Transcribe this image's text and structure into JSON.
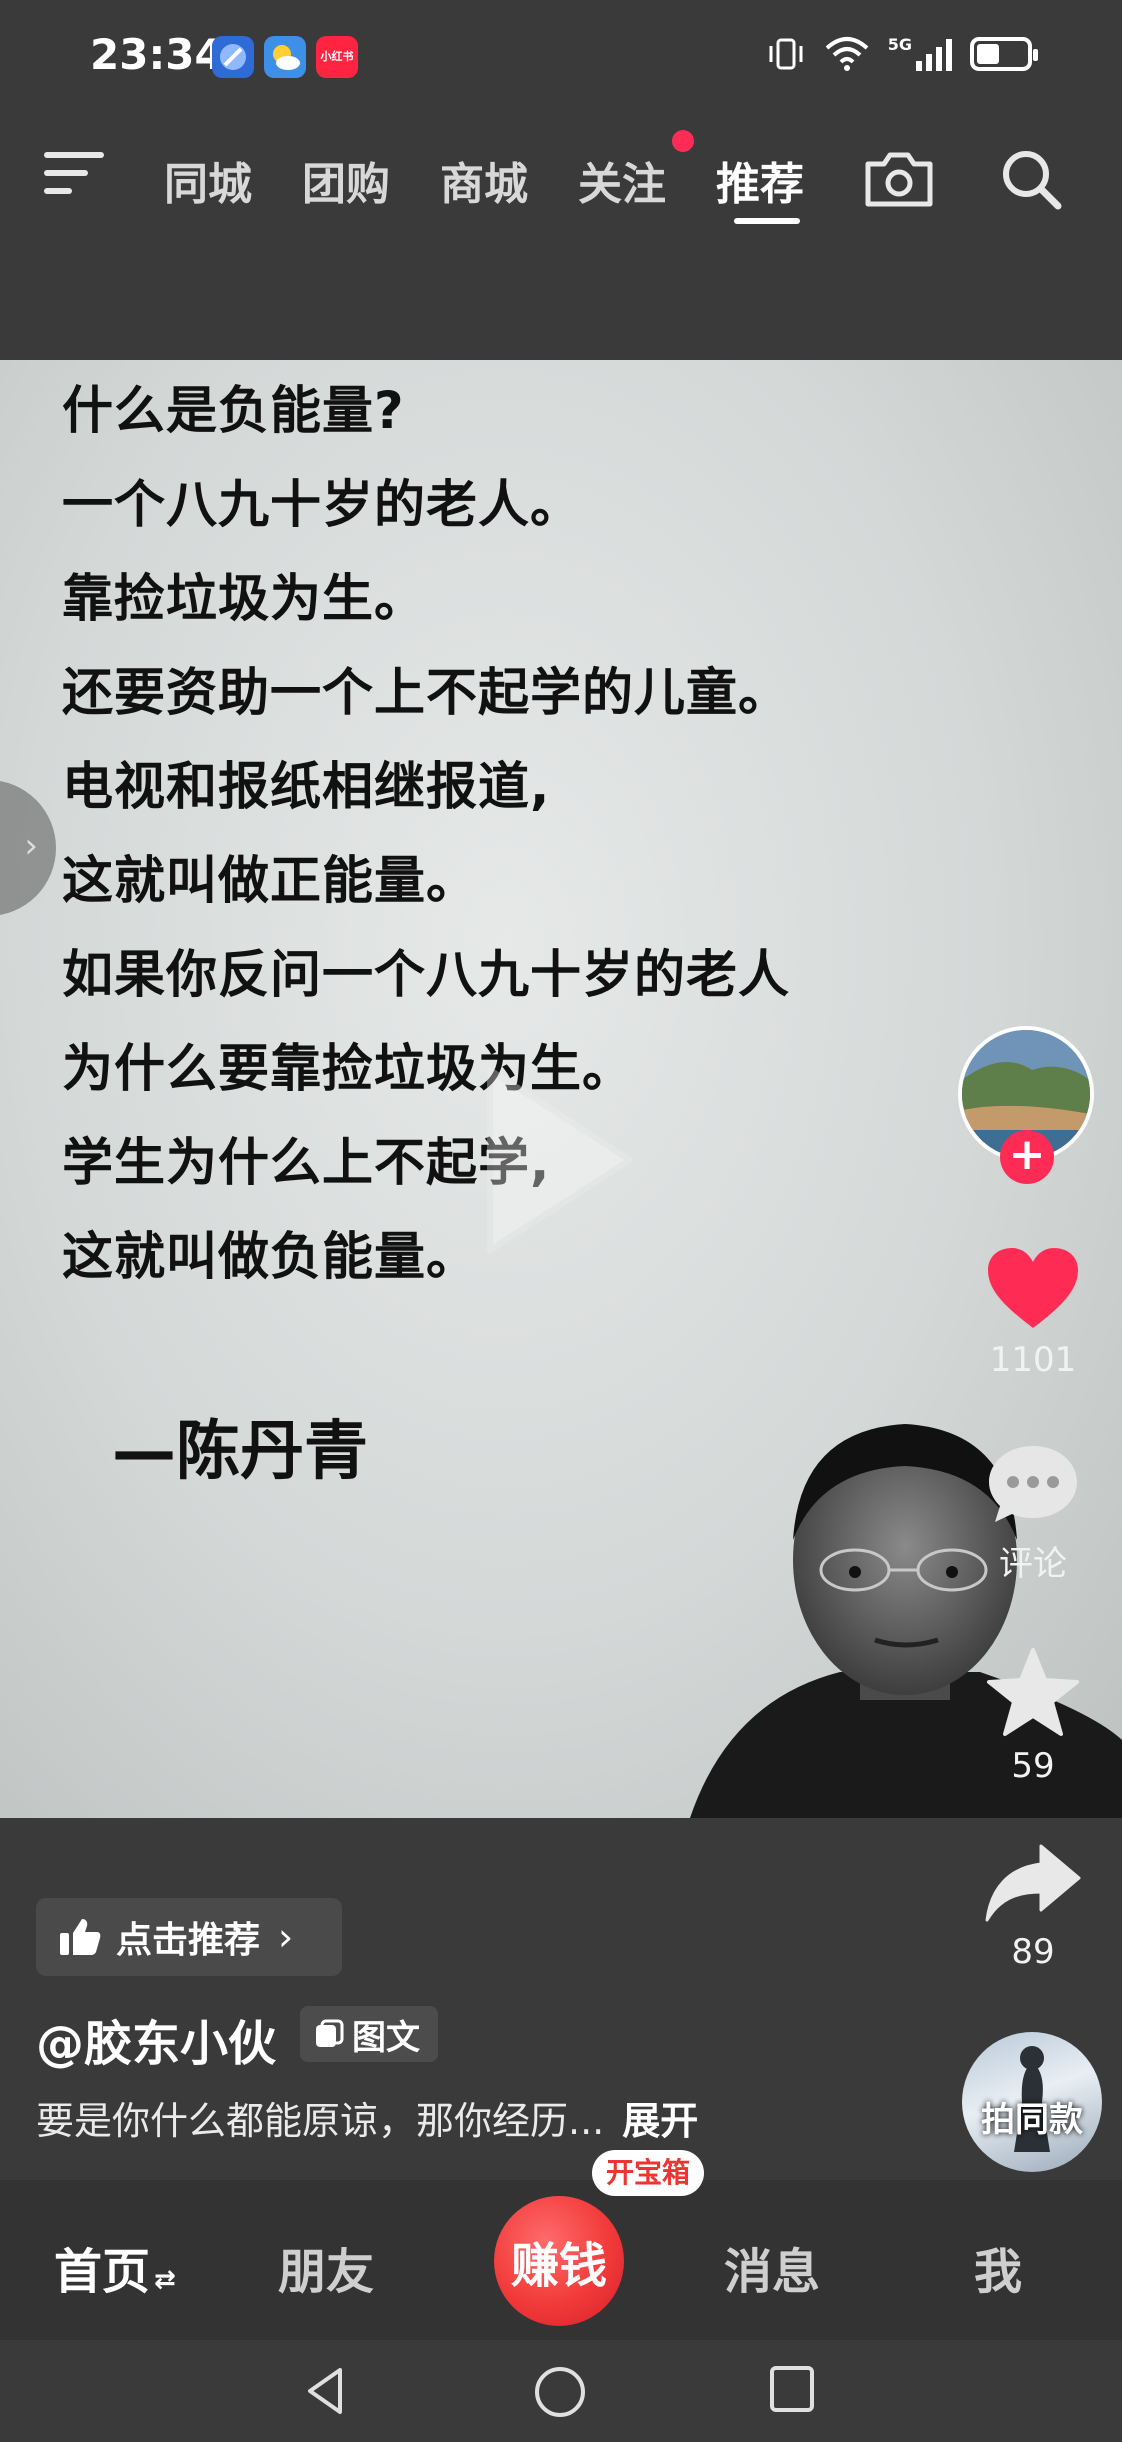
{
  "status_bar": {
    "time": "23:34",
    "network": "5G",
    "app_icons": [
      "browser-icon",
      "weather-icon",
      "xiaohongshu-icon"
    ],
    "xiaohongshu_label": "小红书"
  },
  "top_nav": {
    "tabs": [
      {
        "label": "同城"
      },
      {
        "label": "团购"
      },
      {
        "label": "商城"
      },
      {
        "label": "关注"
      },
      {
        "label": "推荐"
      }
    ],
    "active_tab": "推荐"
  },
  "content": {
    "lines": [
      "什么是负能量?",
      "一个八九十岁的老人。",
      "靠捡垃圾为生。",
      "还要资助一个上不起学的儿童。",
      "电视和报纸相继报道,",
      "这就叫做正能量。",
      "如果你反问一个八九十岁的老人",
      "为什么要靠捡垃圾为生。",
      "学生为什么上不起学,",
      "这就叫做负能量。"
    ],
    "author": "—陈丹青"
  },
  "actions": {
    "like_count": "1101",
    "comment_label": "评论",
    "favorite_count": "59",
    "share_count": "89",
    "shoot_same_label": "拍同款",
    "follow_symbol": "+"
  },
  "post": {
    "recommend_label": "点击推荐",
    "recommend_chevron": "›",
    "author": "@胶东小伙",
    "type_label": "图文",
    "description": "要是你什么都能原谅，那你经历...",
    "expand_label": "展开"
  },
  "bottom_nav": {
    "home": "首页",
    "home_suffix": "⇄",
    "friends": "朋友",
    "earn": "赚钱",
    "treasure_badge": "开宝箱",
    "messages": "消息",
    "me": "我"
  },
  "colors": {
    "accent_red": "#fe2c55",
    "background": "#3a3a3a",
    "like_heart": "#fe2c55"
  }
}
